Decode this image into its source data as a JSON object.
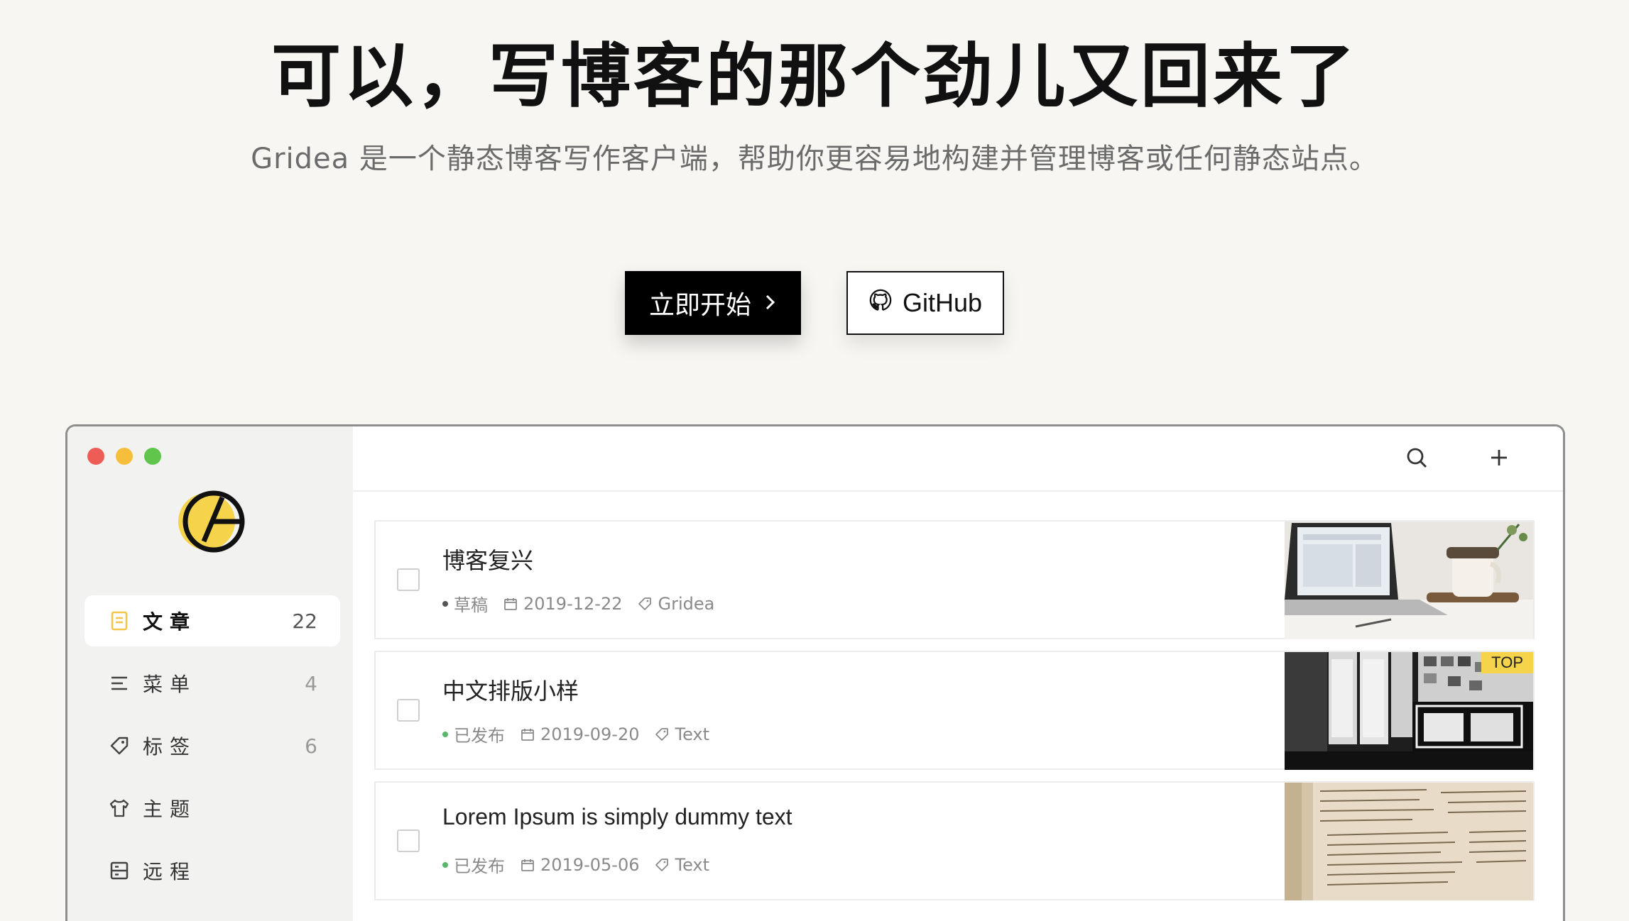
{
  "hero": {
    "title": "可以，写博客的那个劲儿又回来了",
    "subtitle": "Gridea 是一个静态博客写作客户端，帮助你更容易地构建并管理博客或任何静态站点。",
    "start_button": "立即开始",
    "github_button": "GitHub"
  },
  "sidebar": {
    "items": [
      {
        "label": "文章",
        "count": "22",
        "icon": "article-icon"
      },
      {
        "label": "菜单",
        "count": "4",
        "icon": "menu-icon"
      },
      {
        "label": "标签",
        "count": "6",
        "icon": "tag-icon"
      },
      {
        "label": "主题",
        "count": "",
        "icon": "shirt-icon"
      },
      {
        "label": "远程",
        "count": "",
        "icon": "remote-icon"
      }
    ]
  },
  "posts": [
    {
      "title": "博客复兴",
      "status": "草稿",
      "status_color": "#555555",
      "date": "2019-12-22",
      "tag": "Gridea",
      "top": false
    },
    {
      "title": "中文排版小样",
      "status": "已发布",
      "status_color": "#58b76a",
      "date": "2019-09-20",
      "tag": "Text",
      "top": true,
      "top_label": "TOP"
    },
    {
      "title": "Lorem Ipsum is simply dummy text",
      "status": "已发布",
      "status_color": "#58b76a",
      "date": "2019-05-06",
      "tag": "Text",
      "top": false
    }
  ],
  "colors": {
    "accent_yellow": "#f5d34a",
    "published_green": "#58b76a"
  }
}
